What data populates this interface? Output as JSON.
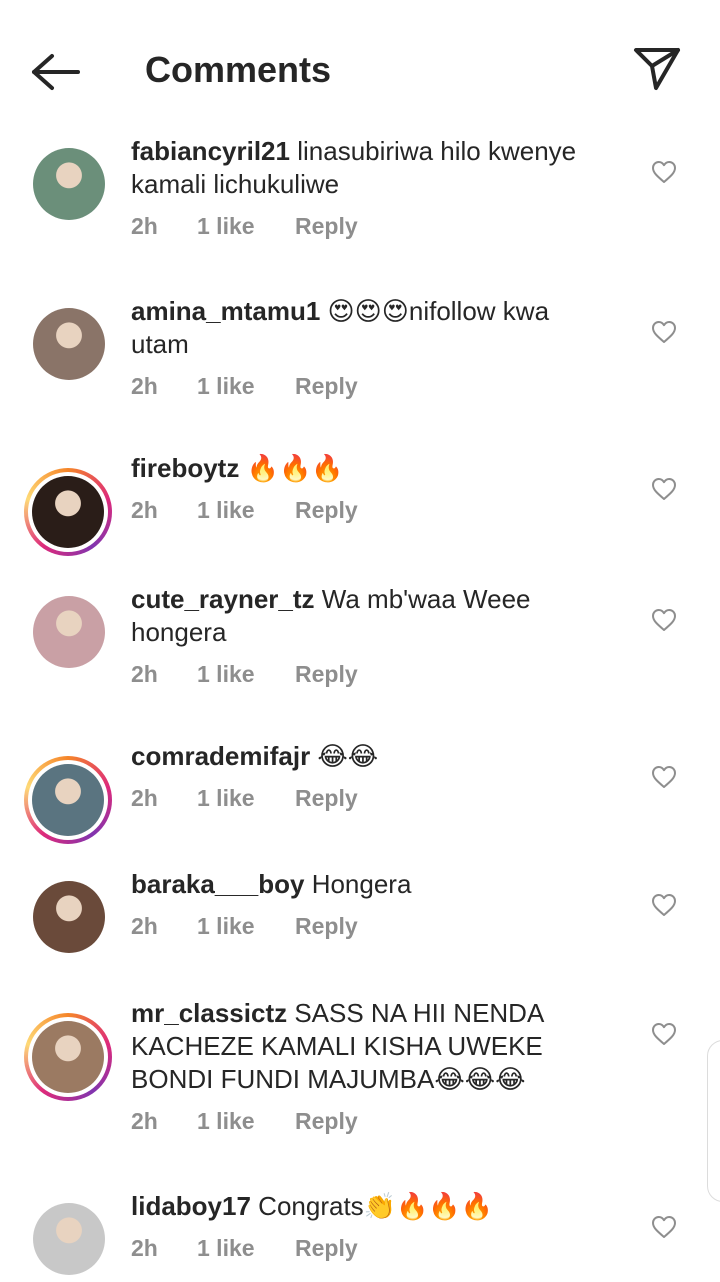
{
  "header": {
    "title": "Comments"
  },
  "comments": [
    {
      "username": "fabiancyril21",
      "text": "linasubiriwa hilo kwenye kamali lichukuliwe",
      "time": "2h",
      "likes": "1 like",
      "reply": "Reply",
      "has_story": false,
      "avatar_color": "#6b8f7a"
    },
    {
      "username": "amina_mtamu1",
      "text": "😍😍😍nifollow kwa utam",
      "time": "2h",
      "likes": "1 like",
      "reply": "Reply",
      "has_story": false,
      "avatar_color": "#8a7468"
    },
    {
      "username": "fireboytz",
      "text": "🔥🔥🔥",
      "time": "2h",
      "likes": "1 like",
      "reply": "Reply",
      "has_story": true,
      "avatar_color": "#2a1d18"
    },
    {
      "username": "cute_rayner_tz",
      "text": "Wa mb'waa Weee hongera",
      "time": "2h",
      "likes": "1 like",
      "reply": "Reply",
      "has_story": false,
      "avatar_color": "#c9a0a5"
    },
    {
      "username": "comrademifajr",
      "text": "😂😂",
      "time": "2h",
      "likes": "1 like",
      "reply": "Reply",
      "has_story": true,
      "avatar_color": "#5a7480"
    },
    {
      "username": "baraka___boy",
      "text": "Hongera",
      "time": "2h",
      "likes": "1 like",
      "reply": "Reply",
      "has_story": false,
      "avatar_color": "#6a4a3a"
    },
    {
      "username": "mr_classictz",
      "text": "SASS NA HII NENDA KACHEZE KAMALI KISHA UWEKE BONDI FUNDI MAJUMBA😂😂😂",
      "time": "2h",
      "likes": "1 like",
      "reply": "Reply",
      "has_story": true,
      "avatar_color": "#9b7a62"
    },
    {
      "username": "lidaboy17",
      "text": "Congrats👏🔥🔥🔥",
      "time": "2h",
      "likes": "1 like",
      "reply": "Reply",
      "has_story": false,
      "avatar_color": "#c8c8c8"
    }
  ]
}
